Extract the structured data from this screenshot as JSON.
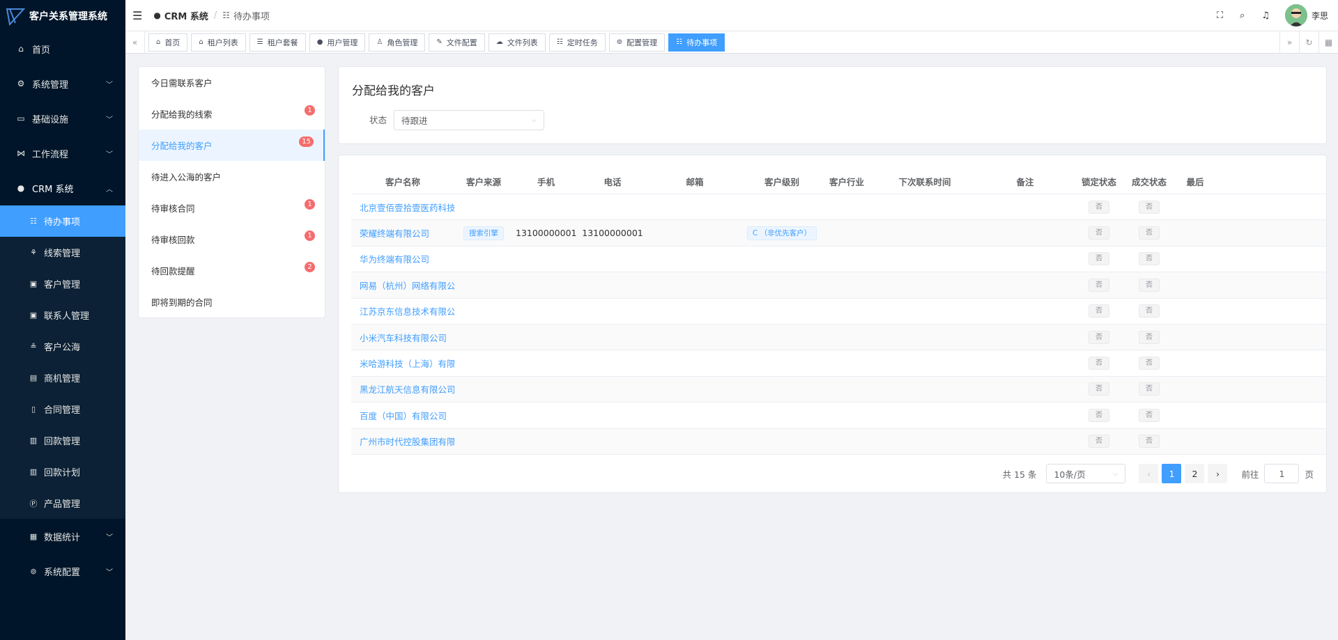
{
  "app": {
    "title": "客户关系管理系统"
  },
  "sidebar": {
    "items": [
      {
        "label": "首页",
        "icon": "home-icon",
        "glyph": "⌂"
      },
      {
        "label": "系统管理",
        "icon": "gear-icon",
        "glyph": "⚙"
      },
      {
        "label": "基础设施",
        "icon": "monitor-icon",
        "glyph": "▭"
      },
      {
        "label": "工作流程",
        "icon": "workflow-icon",
        "glyph": "⋈"
      },
      {
        "label": "CRM 系统",
        "icon": "user-icon",
        "glyph": "●"
      }
    ],
    "crm_sub": [
      {
        "label": "待办事项",
        "icon": "todo-list-icon",
        "glyph": "☷"
      },
      {
        "label": "线索管理",
        "icon": "clue-icon",
        "glyph": "⚘"
      },
      {
        "label": "客户管理",
        "icon": "customer-icon",
        "glyph": "▣"
      },
      {
        "label": "联系人管理",
        "icon": "contact-icon",
        "glyph": "▣"
      },
      {
        "label": "客户公海",
        "icon": "sea-icon",
        "glyph": "≗"
      },
      {
        "label": "商机管理",
        "icon": "bus-icon",
        "glyph": "▤"
      },
      {
        "label": "合同管理",
        "icon": "contract-icon",
        "glyph": "▯"
      },
      {
        "label": "回款管理",
        "icon": "payment-icon",
        "glyph": "▥"
      },
      {
        "label": "回款计划",
        "icon": "plan-icon",
        "glyph": "▥"
      },
      {
        "label": "产品管理",
        "icon": "product-icon",
        "glyph": "Ⓟ"
      },
      {
        "label": "数据统计",
        "icon": "stats-icon",
        "glyph": "▦"
      },
      {
        "label": "系统配置",
        "icon": "config-icon",
        "glyph": "⊚"
      }
    ]
  },
  "header": {
    "crumb1": "CRM 系统",
    "crumb2": "待办事项",
    "user": "李思"
  },
  "tabs": [
    "首页",
    "租户列表",
    "租户套餐",
    "用户管理",
    "角色管理",
    "文件配置",
    "文件列表",
    "定时任务",
    "配置管理",
    "待办事项"
  ],
  "todo_menu": [
    {
      "label": "今日需联系客户",
      "badge": ""
    },
    {
      "label": "分配给我的线索",
      "badge": "1"
    },
    {
      "label": "分配给我的客户",
      "badge": "15"
    },
    {
      "label": "待进入公海的客户",
      "badge": ""
    },
    {
      "label": "待审核合同",
      "badge": "1"
    },
    {
      "label": "待审核回款",
      "badge": "1"
    },
    {
      "label": "待回款提醒",
      "badge": "2"
    },
    {
      "label": "即将到期的合同",
      "badge": ""
    }
  ],
  "filter": {
    "title": "分配给我的客户",
    "status_label": "状态",
    "status_value": "待跟进"
  },
  "table": {
    "columns": [
      "客户名称",
      "客户来源",
      "手机",
      "电话",
      "邮箱",
      "客户级别",
      "客户行业",
      "下次联系时间",
      "备注",
      "锁定状态",
      "成交状态",
      "最后"
    ],
    "rows": [
      {
        "name": "北京壹佰壹拾壹医药科技",
        "source": "",
        "mobile": "",
        "phone": "",
        "email": "",
        "level": "",
        "industry": "",
        "next": "",
        "remark": "",
        "lock": "否",
        "deal": "否"
      },
      {
        "name": "荣耀终端有限公司",
        "source": "搜索引擎",
        "mobile": "13100000001",
        "phone": "13100000001",
        "email": "",
        "level": "C （非优先客户）",
        "industry": "",
        "next": "",
        "remark": "",
        "lock": "否",
        "deal": "否"
      },
      {
        "name": "华为终端有限公司",
        "source": "",
        "mobile": "",
        "phone": "",
        "email": "",
        "level": "",
        "industry": "",
        "next": "",
        "remark": "",
        "lock": "否",
        "deal": "否"
      },
      {
        "name": "网易（杭州）网络有限公司",
        "source": "",
        "mobile": "",
        "phone": "",
        "email": "",
        "level": "",
        "industry": "",
        "next": "",
        "remark": "",
        "lock": "否",
        "deal": "否"
      },
      {
        "name": "江苏京东信息技术有限公司",
        "source": "",
        "mobile": "",
        "phone": "",
        "email": "",
        "level": "",
        "industry": "",
        "next": "",
        "remark": "",
        "lock": "否",
        "deal": "否"
      },
      {
        "name": "小米汽车科技有限公司",
        "source": "",
        "mobile": "",
        "phone": "",
        "email": "",
        "level": "",
        "industry": "",
        "next": "",
        "remark": "",
        "lock": "否",
        "deal": "否"
      },
      {
        "name": "米哈游科技（上海）有限公司",
        "source": "",
        "mobile": "",
        "phone": "",
        "email": "",
        "level": "",
        "industry": "",
        "next": "",
        "remark": "",
        "lock": "否",
        "deal": "否"
      },
      {
        "name": "黑龙江航天信息有限公司",
        "source": "",
        "mobile": "",
        "phone": "",
        "email": "",
        "level": "",
        "industry": "",
        "next": "",
        "remark": "",
        "lock": "否",
        "deal": "否"
      },
      {
        "name": "百度（中国）有限公司",
        "source": "",
        "mobile": "",
        "phone": "",
        "email": "",
        "level": "",
        "industry": "",
        "next": "",
        "remark": "",
        "lock": "否",
        "deal": "否"
      },
      {
        "name": "广州市时代控股集团有限公司",
        "source": "",
        "mobile": "",
        "phone": "",
        "email": "",
        "level": "",
        "industry": "",
        "next": "",
        "remark": "",
        "lock": "否",
        "deal": "否"
      }
    ]
  },
  "pagination": {
    "total": "共 15 条",
    "page_size": "10条/页",
    "pages": [
      "1",
      "2"
    ],
    "goto_label": "前往",
    "goto_value": "1",
    "page_suffix": "页"
  },
  "colors": {
    "accent": "#409eff",
    "sidebar_bg": "#001529",
    "badge": "#f56c6c"
  }
}
